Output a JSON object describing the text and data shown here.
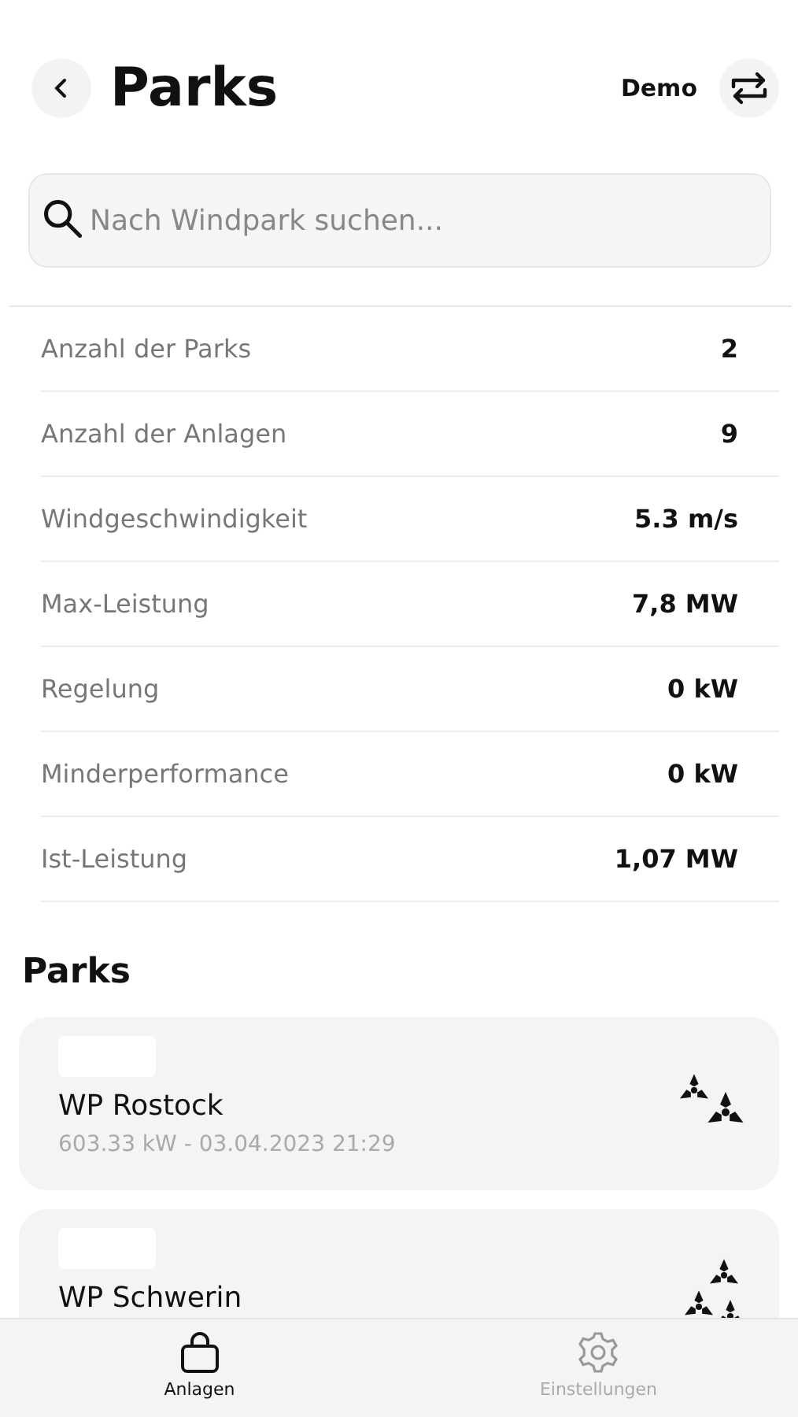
{
  "header": {
    "title": "Parks",
    "account": "Demo"
  },
  "search": {
    "placeholder": "Nach Windpark suchen..."
  },
  "stats": [
    {
      "label": "Anzahl der Parks",
      "value": "2"
    },
    {
      "label": "Anzahl der Anlagen",
      "value": "9"
    },
    {
      "label": "Windgeschwindigkeit",
      "value": "5.3 m/s"
    },
    {
      "label": "Max-Leistung",
      "value": "7,8 MW"
    },
    {
      "label": "Regelung",
      "value": "0 kW"
    },
    {
      "label": "Minderperformance",
      "value": "0 kW"
    },
    {
      "label": "Ist-Leistung",
      "value": "1,07 MW"
    }
  ],
  "parks_heading": "Parks",
  "parks": [
    {
      "name": "WP Rostock",
      "detail": "603.33 kW - 03.04.2023 21:29"
    },
    {
      "name": "WP Schwerin"
    }
  ],
  "tab_bar": [
    {
      "label": "Anlagen",
      "kind": "bag",
      "selected": true
    },
    {
      "label": "Einstellungen",
      "kind": "gear",
      "selected": false
    }
  ]
}
